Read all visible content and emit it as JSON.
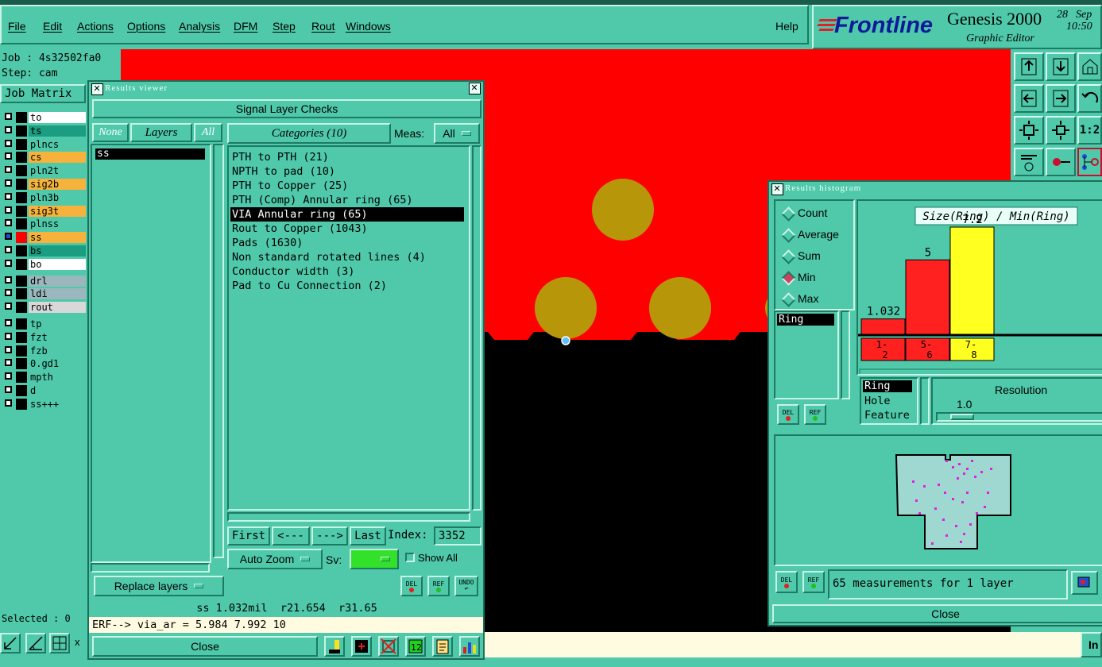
{
  "menubar": {
    "items": [
      "File",
      "Edit",
      "Actions",
      "Options",
      "Analysis",
      "DFM",
      "Step",
      "Rout",
      "Windows"
    ],
    "help": "Help"
  },
  "brand": {
    "logo": "Frontline",
    "product": "Genesis 2000",
    "subtitle": "Graphic Editor",
    "date_day": "28",
    "date_month": "Sep",
    "time": "10:50"
  },
  "job": {
    "job_label": "Job : 4s32502fa0",
    "step_label": "Step: cam",
    "matrix_button": "Job Matrix",
    "selected": "Selected : 0"
  },
  "layers": [
    {
      "name": "to",
      "color": "#ffffff"
    },
    {
      "name": "ts",
      "color": "#1a9d80"
    },
    {
      "name": "plncs",
      "color": "#4fc9a9"
    },
    {
      "name": "cs",
      "color": "#f7b23c"
    },
    {
      "name": "pln2t",
      "color": "#4fc9a9"
    },
    {
      "name": "sig2b",
      "color": "#f7b23c"
    },
    {
      "name": "pln3b",
      "color": "#4fc9a9"
    },
    {
      "name": "sig3t",
      "color": "#f7b23c"
    },
    {
      "name": "plnss",
      "color": "#4fc9a9"
    },
    {
      "name": "ss",
      "color": "#f7b23c"
    },
    {
      "name": "bs",
      "color": "#1a9d80"
    },
    {
      "name": "bo",
      "color": "#ffffff"
    },
    {
      "name": "drl",
      "color": "#9bb7bd"
    },
    {
      "name": "ldi",
      "color": "#9bb7bd"
    },
    {
      "name": "rout",
      "color": "#d8d8d8"
    },
    {
      "name": "tp",
      "color": "#4fc9a9"
    },
    {
      "name": "fzt",
      "color": "#4fc9a9"
    },
    {
      "name": "fzb",
      "color": "#4fc9a9"
    },
    {
      "name": "0.gd1",
      "color": "#4fc9a9"
    },
    {
      "name": "mpth",
      "color": "#4fc9a9"
    },
    {
      "name": "d",
      "color": "#4fc9a9"
    },
    {
      "name": "ss+++",
      "color": "#4fc9a9"
    }
  ],
  "results_viewer": {
    "title": "Results viewer",
    "header": "Signal Layer Checks",
    "none_btn": "None",
    "layers_btn": "Layers",
    "all_btn": "All",
    "categories_btn": "Categories (10)",
    "meas_label": "Meas:",
    "meas_value": "All",
    "layer_list": [
      "ss"
    ],
    "categories": [
      "PTH to PTH (21)",
      "NPTH to pad (10)",
      "PTH to Copper (25)",
      "PTH (Comp) Annular ring (65)",
      "VIA Annular ring (65)",
      "Rout to Copper (1043)",
      "Pads (1630)",
      "Non standard rotated lines (4)",
      "Conductor width (3)",
      "Pad to Cu Connection (2)"
    ],
    "selected_category": "VIA Annular ring (65)",
    "first_btn": "First",
    "prev_btn": "<---",
    "next_btn": "--->",
    "last_btn": "Last",
    "index_label": "Index:",
    "index_value": "3352",
    "auto_zoom": "Auto Zoom",
    "sv_label": "Sv:",
    "show_all": "Show All",
    "replace_layers": "Replace layers",
    "del_label": "DEL",
    "ref_label": "REF",
    "undo_label": "UNDO",
    "status_line": "ss 1.032mil  r21.654  r31.65",
    "erf_line": "ERF--> via_ar = 5.984 7.992 10",
    "close": "Close"
  },
  "histogram": {
    "title": "Results histogram",
    "modes": [
      "Count",
      "Average",
      "Sum",
      "Min",
      "Max"
    ],
    "selected_mode": "Min",
    "chart_title": "Size(Ring) / Min(Ring)",
    "list": [
      "Ring"
    ],
    "criteria": [
      "Ring",
      "Hole",
      "Feature"
    ],
    "resolution_label": "Resolution",
    "resolution_value": "1.0",
    "status": "65 measurements for 1 layer",
    "close": "Close",
    "del_label": "DEL",
    "ref_label": "REF"
  },
  "chart_data": {
    "type": "bar",
    "title": "Size(Ring) / Min(Ring)",
    "categories": [
      "1-\n2",
      "5-\n6",
      "7-\n8"
    ],
    "values": [
      1.032,
      5,
      7.2
    ],
    "data_labels": [
      "1.032",
      "5",
      "7.2"
    ],
    "colors": [
      "#ff2020",
      "#ff2020",
      "#ffff20"
    ],
    "ylim": [
      0,
      8
    ]
  },
  "bottom": {
    "input_btn": "In",
    "x_label": "x"
  },
  "colors": {
    "accent": "#4fc9a9",
    "canvas_red": "#ff0000",
    "pad": "#b8960a"
  }
}
